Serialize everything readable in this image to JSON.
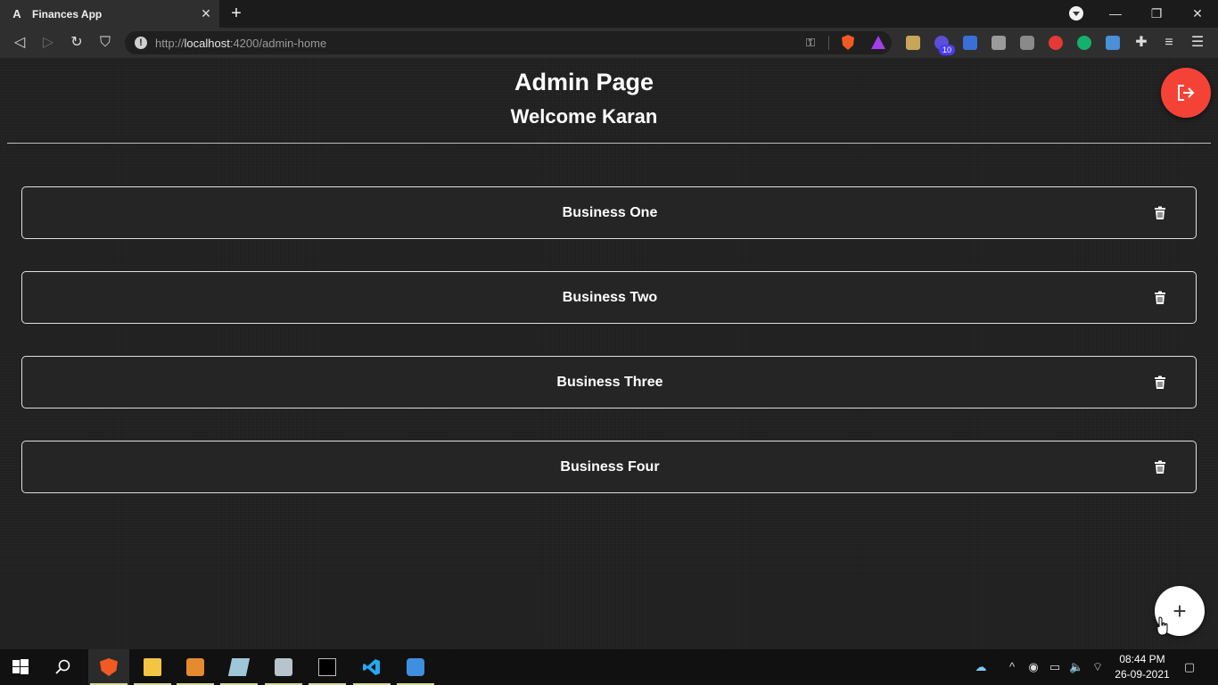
{
  "browser": {
    "tab_title": "Finances App",
    "tab_favicon": "A",
    "url_host": "localhost",
    "url_prefix": "http://",
    "url_path": ":4200/admin-home"
  },
  "header": {
    "title": "Admin Page",
    "subtitle": "Welcome Karan"
  },
  "businesses": [
    {
      "name": "Business One"
    },
    {
      "name": "Business Two"
    },
    {
      "name": "Business Three"
    },
    {
      "name": "Business Four"
    }
  ],
  "actions": {
    "logout_icon": "logout-icon",
    "add_icon": "plus-icon",
    "add_label": "+",
    "delete_icon": "trash-icon"
  },
  "taskbar": {
    "time": "08:44 PM",
    "date": "26-09-2021"
  },
  "colors": {
    "logout": "#f44336",
    "background": "#202020",
    "card_border": "#e0e0e0"
  }
}
